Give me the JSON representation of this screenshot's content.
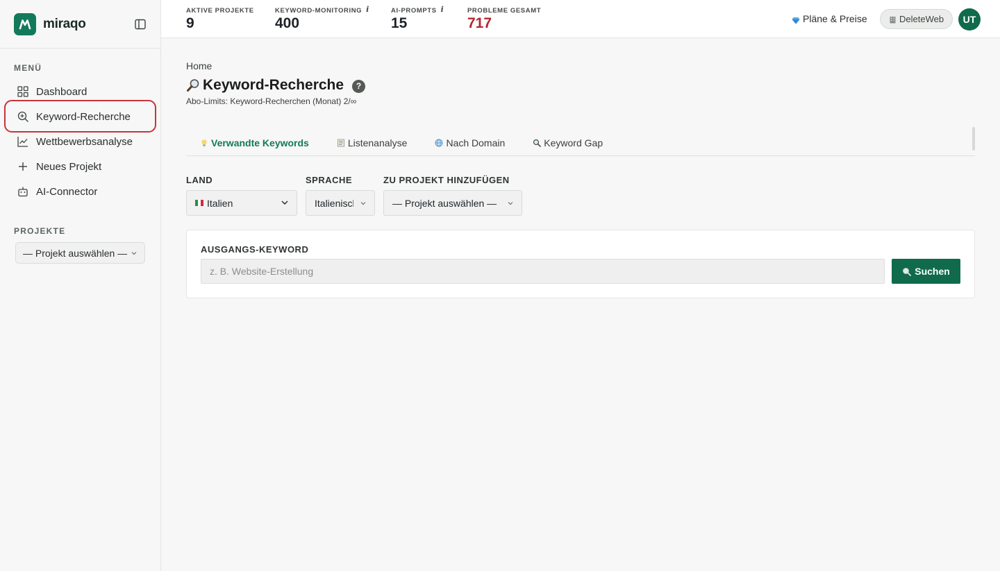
{
  "brand": {
    "name": "miraqo"
  },
  "sidebar": {
    "menu_label": "MENÜ",
    "items": [
      {
        "label": "Dashboard",
        "icon": "grid-icon"
      },
      {
        "label": "Keyword-Recherche",
        "icon": "search-plus-icon",
        "highlighted": true
      },
      {
        "label": "Wettbewerbsanalyse",
        "icon": "line-chart-icon"
      },
      {
        "label": "Neues Projekt",
        "icon": "plus-icon"
      },
      {
        "label": "AI-Connector",
        "icon": "robot-icon"
      }
    ],
    "projects_label": "PROJEKTE",
    "project_select": "— Projekt auswählen —"
  },
  "topbar": {
    "stats": [
      {
        "label": "AKTIVE PROJEKTE",
        "value": "9",
        "info": ""
      },
      {
        "label": "KEYWORD-MONITORING",
        "value": "400",
        "info": "i"
      },
      {
        "label": "AI-PROMPTS",
        "value": "15",
        "info": "i"
      },
      {
        "label": "PROBLEME GESAMT",
        "value": "717",
        "info": ""
      }
    ],
    "plans_label": "Pläne & Preise",
    "workspace_label": "DeleteWeb",
    "avatar_initials": "UT"
  },
  "main": {
    "breadcrumb": "Home",
    "title": "Keyword-Recherche",
    "help": "?",
    "limits": "Abo-Limits: Keyword-Recherchen (Monat) 2/∞",
    "tabs": [
      {
        "label": "Verwandte Keywords",
        "icon": "lightbulb-icon",
        "active": true
      },
      {
        "label": "Listenanalyse",
        "icon": "list-icon"
      },
      {
        "label": "Nach Domain",
        "icon": "globe-icon"
      },
      {
        "label": "Keyword Gap",
        "icon": "magnifier-icon"
      }
    ],
    "filters": {
      "country_label": "LAND",
      "country_value": "Italien",
      "language_label": "SPRACHE",
      "language_value": "Italienisch",
      "project_label": "ZU PROJEKT HINZUFÜGEN",
      "project_value": "— Projekt auswählen —"
    },
    "search": {
      "label": "AUSGANGS-KEYWORD",
      "placeholder": "z. B. Website-Erstellung",
      "value": "",
      "button_label": "Suchen"
    }
  },
  "colors": {
    "accent": "#13795b",
    "accent_dark": "#0f6b4b",
    "problem_red": "#b3262f",
    "highlight_ring": "#c8333b"
  }
}
